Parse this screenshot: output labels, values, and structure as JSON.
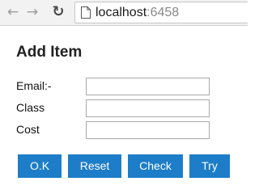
{
  "browser": {
    "url_host": "localhost",
    "url_port": ":6458",
    "icons": {
      "back": "back-arrow-icon",
      "forward": "forward-arrow-icon",
      "reload": "reload-icon",
      "page": "page-icon"
    }
  },
  "form": {
    "title": "Add Item",
    "fields": [
      {
        "label": "Email:-",
        "value": ""
      },
      {
        "label": "Class",
        "value": ""
      },
      {
        "label": "Cost",
        "value": ""
      }
    ]
  },
  "buttons": {
    "ok": "O.K",
    "reset": "Reset",
    "check": "Check",
    "try": "Try"
  },
  "colors": {
    "button_bg": "#1d7dc8",
    "button_text": "#ffffff"
  }
}
